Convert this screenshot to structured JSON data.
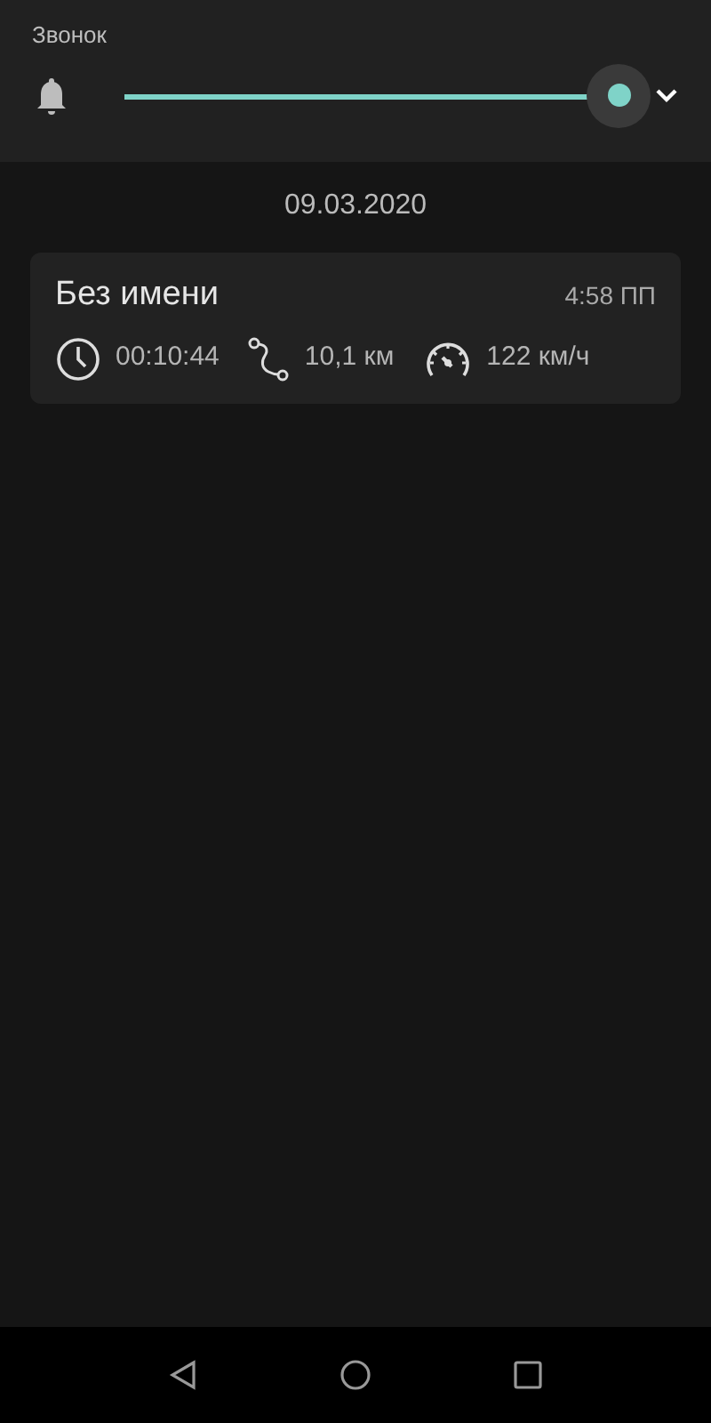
{
  "volume_panel": {
    "label": "Звонок",
    "slider": {
      "level": 1
    }
  },
  "date_header": "09.03.2020",
  "trips": [
    {
      "title": "Без имени",
      "time": "4:58 ПП",
      "duration": "00:10:44",
      "distance": "10,1 км",
      "max_speed": "122 км/ч"
    }
  ]
}
